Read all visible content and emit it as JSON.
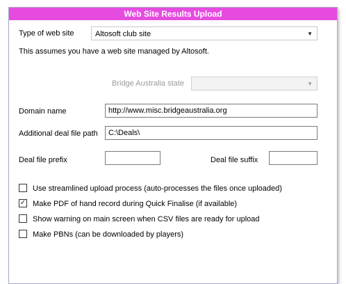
{
  "window": {
    "title": "Web Site Results Upload",
    "title_bg": "#e64be0"
  },
  "type_of_site": {
    "label": "Type of web site",
    "value": "Altosoft club site",
    "note": "This assumes you have a web site managed by Altosoft."
  },
  "state": {
    "label": "Bridge Australia state",
    "value": ""
  },
  "domain": {
    "label": "Domain name",
    "value": "http://www.misc.bridgeaustralia.org"
  },
  "deal_path": {
    "label": "Additional deal file path",
    "value": "C:\\Deals\\"
  },
  "deal_prefix": {
    "label": "Deal file prefix",
    "value": ""
  },
  "deal_suffix": {
    "label": "Deal file suffix",
    "value": ""
  },
  "options": [
    {
      "label": "Use streamlined upload process (auto-processes the files once uploaded)",
      "checked": false,
      "mark": ""
    },
    {
      "label": "Make PDF of hand record during Quick Finalise (if available)",
      "checked": true,
      "mark": "✓"
    },
    {
      "label": "Show warning on main screen when CSV files are ready for upload",
      "checked": false,
      "mark": ""
    },
    {
      "label": "Make PBNs (can be downloaded by players)",
      "checked": false,
      "mark": ""
    }
  ]
}
